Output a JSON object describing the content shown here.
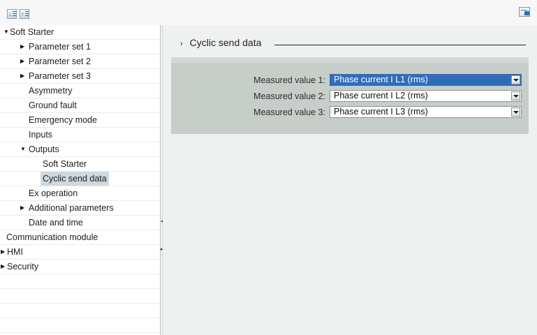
{
  "toolbar": {
    "expand_icon": "expand-all-icon",
    "collapse_icon": "collapse-all-icon",
    "view_icon": "view-toggle-icon"
  },
  "tree": {
    "items": [
      {
        "label": "Soft Starter",
        "expander": "open"
      },
      {
        "label": "Parameter set 1",
        "expander": "closed"
      },
      {
        "label": "Parameter set 2",
        "expander": "closed"
      },
      {
        "label": "Parameter set 3",
        "expander": "closed"
      },
      {
        "label": "Asymmetry",
        "expander": "none"
      },
      {
        "label": "Ground fault",
        "expander": "none"
      },
      {
        "label": "Emergency mode",
        "expander": "none"
      },
      {
        "label": "Inputs",
        "expander": "none"
      },
      {
        "label": "Outputs",
        "expander": "open"
      },
      {
        "label": "Soft Starter",
        "expander": "none"
      },
      {
        "label": "Cyclic send data",
        "expander": "none",
        "selected": true
      },
      {
        "label": "Ex operation",
        "expander": "none"
      },
      {
        "label": "Additional parameters",
        "expander": "closed"
      },
      {
        "label": "Date and time",
        "expander": "none"
      },
      {
        "label": "Communication module",
        "expander": "none"
      },
      {
        "label": "HMI",
        "expander": "closed"
      },
      {
        "label": "Security",
        "expander": "closed"
      }
    ]
  },
  "section": {
    "title": "Cyclic send data"
  },
  "fields": [
    {
      "label": "Measured value 1:",
      "value": "Phase current I L1 (rms)"
    },
    {
      "label": "Measured value 2:",
      "value": "Phase current I L2 (rms)"
    },
    {
      "label": "Measured value 3:",
      "value": "Phase current I L3 (rms)"
    }
  ],
  "colors": {
    "selection": "#cfd8df",
    "active_dropdown": "#2f6dbb",
    "panel": "#c7cdc9"
  }
}
